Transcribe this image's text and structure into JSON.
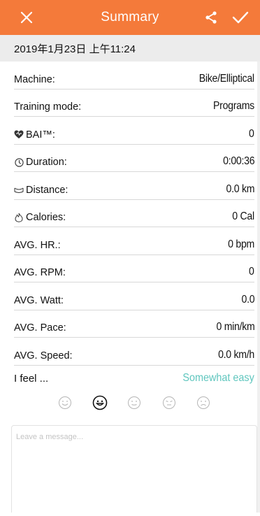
{
  "header": {
    "title": "Summary",
    "close_icon": "close-icon",
    "share_icon": "share-icon",
    "confirm_icon": "checkmark-icon",
    "accent_color": "#f47a3a"
  },
  "date_bar": {
    "text": "2019年1月23日 上午11:24"
  },
  "summary": {
    "rows": [
      {
        "label": "Machine:",
        "value": "Bike/Elliptical",
        "icon": ""
      },
      {
        "label": "Training mode:",
        "value": "Programs",
        "icon": ""
      },
      {
        "label": "BAI™:",
        "value": "0",
        "icon": "heart-icon"
      },
      {
        "label": "Duration:",
        "value": "0:00:36",
        "icon": "clock-icon"
      },
      {
        "label": "Distance:",
        "value": "0.0 km",
        "icon": "distance-icon"
      },
      {
        "label": "Calories:",
        "value": "0 Cal",
        "icon": "flame-icon"
      },
      {
        "label": "AVG. HR.:",
        "value": "0 bpm",
        "icon": ""
      },
      {
        "label": "AVG. RPM:",
        "value": "0",
        "icon": ""
      },
      {
        "label": "AVG. Watt:",
        "value": "0.0",
        "icon": ""
      },
      {
        "label": "AVG. Pace:",
        "value": "0 min/km",
        "icon": ""
      },
      {
        "label": "AVG. Speed:",
        "value": "0.0 km/h",
        "icon": ""
      }
    ]
  },
  "feel": {
    "label": "I feel ...",
    "value": "Somewhat easy",
    "value_color": "#5fc6be",
    "faces": [
      "very-easy-face-icon",
      "somewhat-easy-face-icon",
      "neutral-face-icon",
      "hard-face-icon",
      "very-hard-face-icon"
    ],
    "selected_index": 1
  },
  "message": {
    "placeholder": "Leave a message..."
  }
}
